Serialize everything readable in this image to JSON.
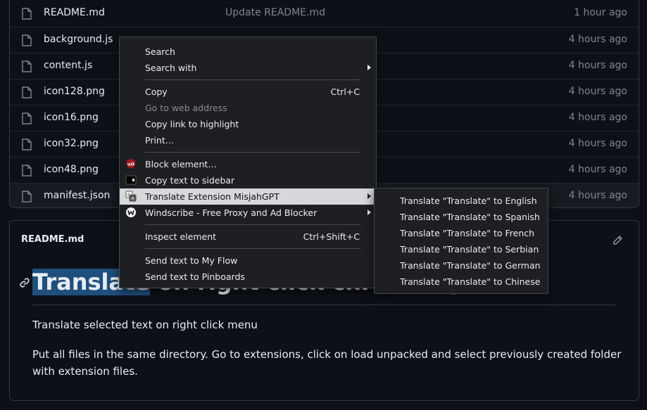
{
  "files": [
    {
      "name": "README.md",
      "message": "Update README.md",
      "time": "1 hour ago"
    },
    {
      "name": "background.js",
      "message": "",
      "time": "4 hours ago"
    },
    {
      "name": "content.js",
      "message": "",
      "time": "4 hours ago"
    },
    {
      "name": "icon128.png",
      "message": "",
      "time": "4 hours ago"
    },
    {
      "name": "icon16.png",
      "message": "",
      "time": "4 hours ago"
    },
    {
      "name": "icon32.png",
      "message": "",
      "time": "4 hours ago"
    },
    {
      "name": "icon48.png",
      "message": "",
      "time": "4 hours ago"
    },
    {
      "name": "manifest.json",
      "message": "",
      "time": "4 hours ago"
    }
  ],
  "readme": {
    "header": "README.md",
    "h1_selected": "Translate",
    "h1_rest": " on right click chrome ap",
    "p1": "Translate selected text on right click menu",
    "p2": "Put all files in the same directory. Go to extensions, click on load unpacked and select previously created folder with extension files."
  },
  "context_menu": {
    "search": "Search",
    "search_with": "Search with",
    "copy": "Copy",
    "copy_shortcut": "Ctrl+C",
    "go_to_web_address": "Go to web address",
    "copy_link_to_highlight": "Copy link to highlight",
    "print": "Print…",
    "block_element": "Block element…",
    "copy_text_to_sidebar": "Copy text to sidebar",
    "translate_extension": "Translate Extension MisjahGPT",
    "windscribe": "Windscribe - Free Proxy and Ad Blocker",
    "inspect_element": "Inspect element",
    "inspect_shortcut": "Ctrl+Shift+C",
    "send_to_my_flow": "Send text to My Flow",
    "send_to_pinboards": "Send text to Pinboards"
  },
  "submenu": [
    "Translate \"Translate\" to English",
    "Translate \"Translate\" to Spanish",
    "Translate \"Translate\" to French",
    "Translate \"Translate\" to Serbian",
    "Translate \"Translate\" to German",
    "Translate \"Translate\" to Chinese"
  ],
  "colors": {
    "accent": "#1f4f7d",
    "background": "#0d1117",
    "menu_bg": "#1e1f22"
  }
}
